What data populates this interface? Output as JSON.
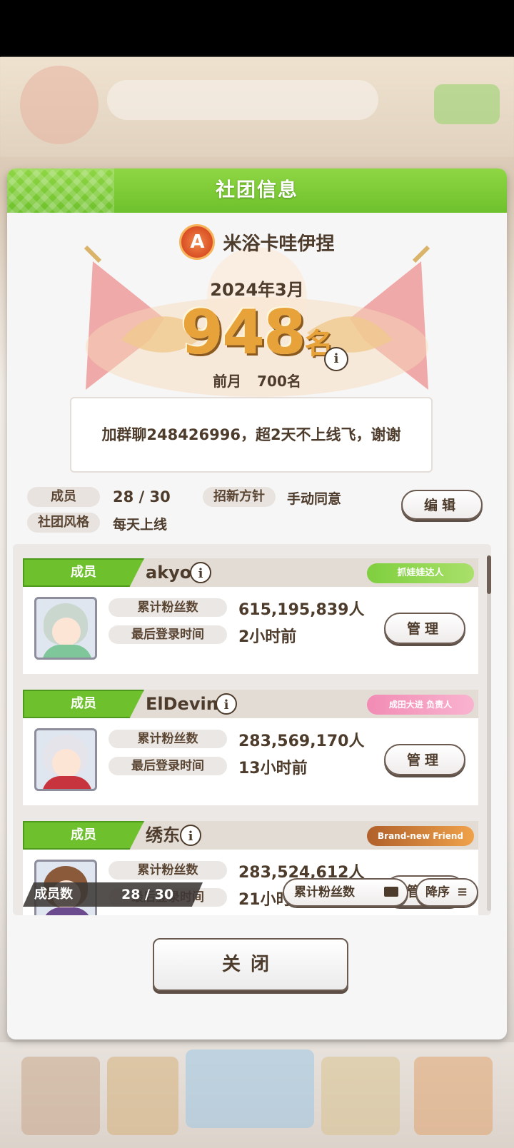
{
  "dialog": {
    "title": "社团信息",
    "club_name": "米浴卡哇伊捏",
    "club_emblem_letter": "A",
    "month": "2024年3月",
    "rank_number": "948",
    "rank_unit": "名",
    "prev_label": "前月",
    "prev_value": "700名",
    "notice": "加群聊248426996，超2天不上线飞，谢谢",
    "info": {
      "members_label": "成员",
      "members_value": "28 / 30",
      "recruit_label": "招新方针",
      "recruit_value": "手动同意",
      "style_label": "社团风格",
      "style_value": "每天上线",
      "edit_label": "编辑"
    },
    "members": [
      {
        "role": "成员",
        "name": "akyo",
        "badge": "抓娃娃达人",
        "fans_label": "累计粉丝数",
        "fans_value": "615,195,839人",
        "login_label": "最后登录时间",
        "login_value": "2小时前",
        "manage_label": "管理"
      },
      {
        "role": "成员",
        "name": "ElDevin",
        "badge": "成田大进 负责人",
        "fans_label": "累计粉丝数",
        "fans_value": "283,569,170人",
        "login_label": "最后登录时间",
        "login_value": "13小时前",
        "manage_label": "管理"
      },
      {
        "role": "成员",
        "name": "绣东",
        "badge": "Brand-new Friend",
        "fans_label": "累计粉丝数",
        "fans_value": "283,524,612人",
        "login_label": "最后登录时间",
        "login_value": "21小时前",
        "manage_label": "管理"
      }
    ],
    "footer": {
      "count_label": "成员数",
      "count_value": "28 / 30",
      "sort_field": "累计粉丝数",
      "sort_order": "降序"
    },
    "close_label": "关闭"
  },
  "colors": {
    "header_green": "#6ec12c",
    "text_brown": "#4d3b2b",
    "rank_gold": "#e7a23a"
  }
}
